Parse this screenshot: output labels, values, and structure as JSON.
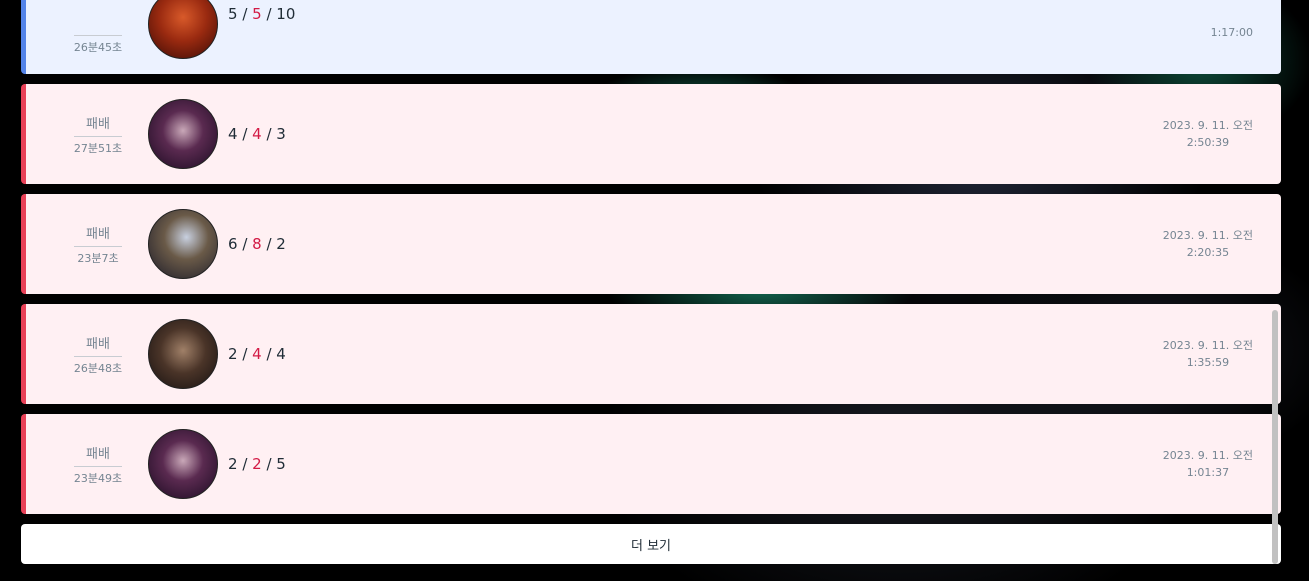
{
  "matches": [
    {
      "result": "",
      "duration": "26분45초",
      "kda": {
        "kills": "5",
        "deaths": "5",
        "assists": "10"
      },
      "date": "",
      "time": "1:17:00",
      "outcome": "win",
      "champion_icon": "champion-gragas-avatar"
    },
    {
      "result": "패배",
      "duration": "27분51초",
      "kda": {
        "kills": "4",
        "deaths": "4",
        "assists": "3"
      },
      "date": "2023. 9. 11. 오전",
      "time": "2:50:39",
      "outcome": "loss",
      "champion_icon": "champion-leblanc-avatar"
    },
    {
      "result": "패배",
      "duration": "23분7초",
      "kda": {
        "kills": "6",
        "deaths": "8",
        "assists": "2"
      },
      "date": "2023. 9. 11. 오전",
      "time": "2:20:35",
      "outcome": "loss",
      "champion_icon": "champion-lux-avatar"
    },
    {
      "result": "패배",
      "duration": "26분48초",
      "kda": {
        "kills": "2",
        "deaths": "4",
        "assists": "4"
      },
      "date": "2023. 9. 11. 오전",
      "time": "1:35:59",
      "outcome": "loss",
      "champion_icon": "champion-jayce-avatar"
    },
    {
      "result": "패배",
      "duration": "23분49초",
      "kda": {
        "kills": "2",
        "deaths": "2",
        "assists": "5"
      },
      "date": "2023. 9. 11. 오전",
      "time": "1:01:37",
      "outcome": "loss",
      "champion_icon": "champion-leblanc-avatar"
    }
  ],
  "more_button": {
    "label": "더 보기"
  },
  "colors": {
    "loss_bg": "#fff0f3",
    "loss_accent": "#e84057",
    "win_bg": "#ecf2ff",
    "win_accent": "#5383e8",
    "deaths": "#d31a45"
  }
}
